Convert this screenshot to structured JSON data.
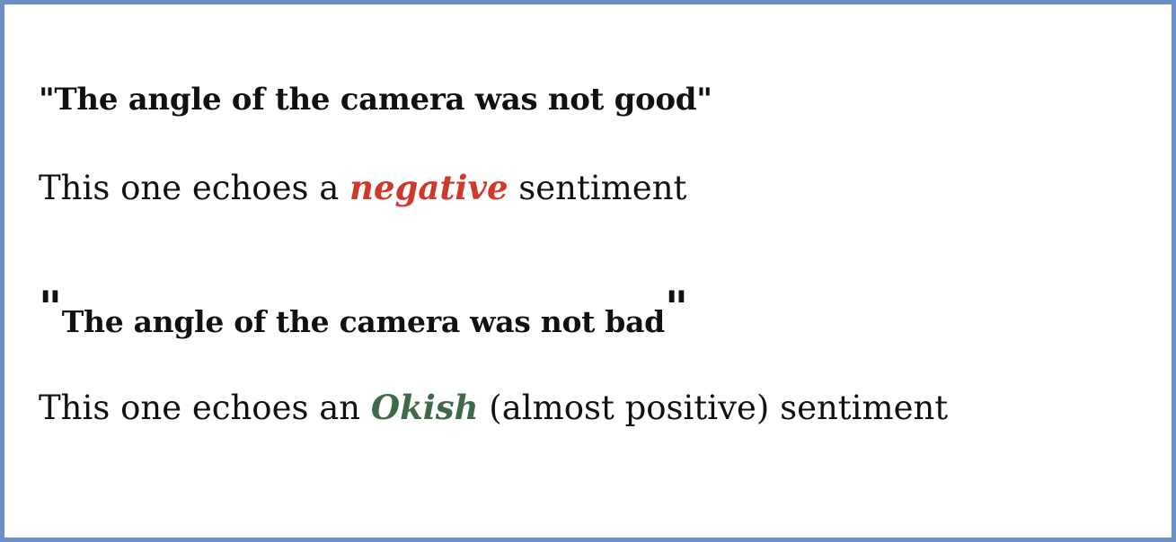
{
  "example1": {
    "quote": "\"The angle of the camera was not good\"",
    "sentence_prefix": "This one echoes a ",
    "sentiment_word": "negative",
    "sentence_suffix": " sentiment",
    "sentiment_color": "#d0382b"
  },
  "example2": {
    "open_quote": "\"",
    "quote": "The angle of the camera was not bad",
    "close_quote": "\"",
    "sentence_prefix": "This one echoes an ",
    "sentiment_word": "Okish",
    "sentence_suffix": " (almost positive) sentiment",
    "sentiment_color": "#3f6a4a"
  },
  "frame_color": "#6b8fc7"
}
